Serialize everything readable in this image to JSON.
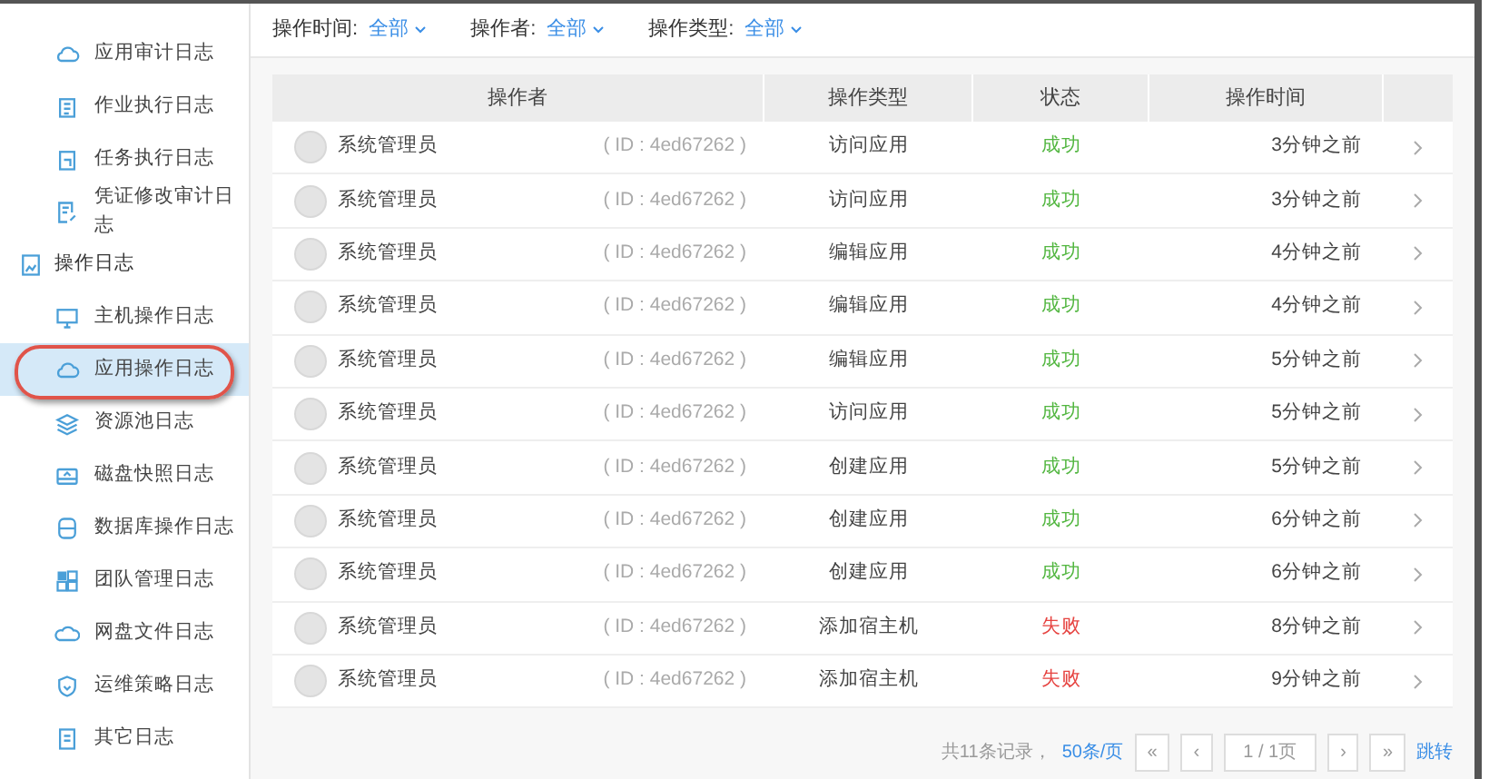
{
  "sidebar": {
    "items": [
      {
        "label": "应用审计日志",
        "selected": false
      },
      {
        "label": "作业执行日志",
        "selected": false
      },
      {
        "label": "任务执行日志",
        "selected": false
      },
      {
        "label": "凭证修改审计日志",
        "selected": false
      }
    ],
    "groups": [
      {
        "label": "操作日志",
        "children": [
          {
            "label": "主机操作日志",
            "selected": false
          },
          {
            "label": "应用操作日志",
            "selected": true
          },
          {
            "label": "资源池日志",
            "selected": false
          },
          {
            "label": "磁盘快照日志",
            "selected": false
          },
          {
            "label": "数据库操作日志",
            "selected": false
          },
          {
            "label": "团队管理日志",
            "selected": false
          },
          {
            "label": "网盘文件日志",
            "selected": false
          },
          {
            "label": "运维策略日志",
            "selected": false
          },
          {
            "label": "其它日志",
            "selected": false
          }
        ]
      }
    ]
  },
  "filters": [
    {
      "label": "操作时间:",
      "value": "全部"
    },
    {
      "label": "操作者:",
      "value": "全部"
    },
    {
      "label": "操作类型:",
      "value": "全部"
    }
  ],
  "table": {
    "columns": [
      "操作者",
      "操作类型",
      "状态",
      "操作时间"
    ],
    "rows": [
      {
        "operator": "系统管理员",
        "id": "( ID : 4ed67262 )",
        "type": "访问应用",
        "status": "成功",
        "color": "#52b640",
        "time": "3分钟之前"
      },
      {
        "operator": "系统管理员",
        "id": "( ID : 4ed67262 )",
        "type": "访问应用",
        "status": "成功",
        "color": "#52b640",
        "time": "3分钟之前"
      },
      {
        "operator": "系统管理员",
        "id": "( ID : 4ed67262 )",
        "type": "编辑应用",
        "status": "成功",
        "color": "#52b640",
        "time": "4分钟之前"
      },
      {
        "operator": "系统管理员",
        "id": "( ID : 4ed67262 )",
        "type": "编辑应用",
        "status": "成功",
        "color": "#52b640",
        "time": "4分钟之前"
      },
      {
        "operator": "系统管理员",
        "id": "( ID : 4ed67262 )",
        "type": "编辑应用",
        "status": "成功",
        "color": "#52b640",
        "time": "5分钟之前"
      },
      {
        "operator": "系统管理员",
        "id": "( ID : 4ed67262 )",
        "type": "访问应用",
        "status": "成功",
        "color": "#52b640",
        "time": "5分钟之前"
      },
      {
        "operator": "系统管理员",
        "id": "( ID : 4ed67262 )",
        "type": "创建应用",
        "status": "成功",
        "color": "#52b640",
        "time": "5分钟之前"
      },
      {
        "operator": "系统管理员",
        "id": "( ID : 4ed67262 )",
        "type": "创建应用",
        "status": "成功",
        "color": "#52b640",
        "time": "6分钟之前"
      },
      {
        "operator": "系统管理员",
        "id": "( ID : 4ed67262 )",
        "type": "创建应用",
        "status": "成功",
        "color": "#52b640",
        "time": "6分钟之前"
      },
      {
        "operator": "系统管理员",
        "id": "( ID : 4ed67262 )",
        "type": "添加宿主机",
        "status": "失败",
        "color": "#e64340",
        "time": "8分钟之前"
      },
      {
        "operator": "系统管理员",
        "id": "( ID : 4ed67262 )",
        "type": "添加宿主机",
        "status": "失败",
        "color": "#e64340",
        "time": "9分钟之前"
      }
    ]
  },
  "pagination": {
    "total": "共11条记录，",
    "page_size": "50条/页",
    "buttons": [
      "«",
      "‹"
    ],
    "page": "1 / 1页",
    "next_buttons": [
      "›",
      "»"
    ],
    "jump": "跳转"
  }
}
